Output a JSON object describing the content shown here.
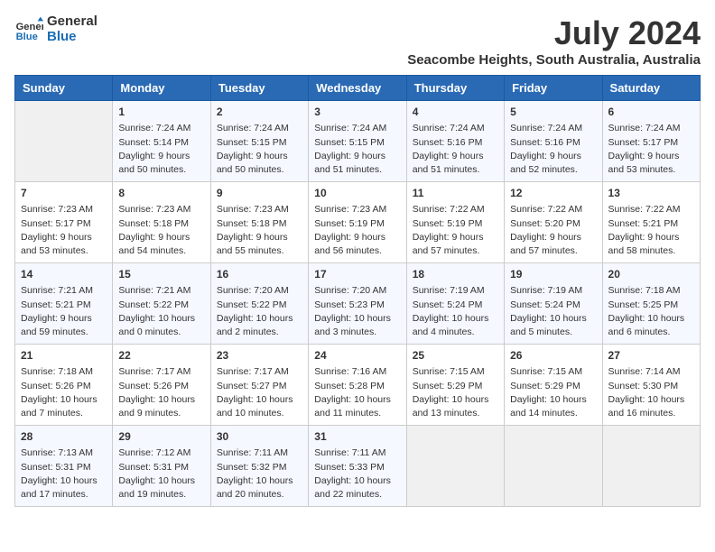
{
  "header": {
    "logo_line1": "General",
    "logo_line2": "Blue",
    "month_year": "July 2024",
    "location": "Seacombe Heights, South Australia, Australia"
  },
  "weekdays": [
    "Sunday",
    "Monday",
    "Tuesday",
    "Wednesday",
    "Thursday",
    "Friday",
    "Saturday"
  ],
  "weeks": [
    [
      {
        "day": "",
        "sunrise": "",
        "sunset": "",
        "daylight": ""
      },
      {
        "day": "1",
        "sunrise": "Sunrise: 7:24 AM",
        "sunset": "Sunset: 5:14 PM",
        "daylight": "Daylight: 9 hours and 50 minutes."
      },
      {
        "day": "2",
        "sunrise": "Sunrise: 7:24 AM",
        "sunset": "Sunset: 5:15 PM",
        "daylight": "Daylight: 9 hours and 50 minutes."
      },
      {
        "day": "3",
        "sunrise": "Sunrise: 7:24 AM",
        "sunset": "Sunset: 5:15 PM",
        "daylight": "Daylight: 9 hours and 51 minutes."
      },
      {
        "day": "4",
        "sunrise": "Sunrise: 7:24 AM",
        "sunset": "Sunset: 5:16 PM",
        "daylight": "Daylight: 9 hours and 51 minutes."
      },
      {
        "day": "5",
        "sunrise": "Sunrise: 7:24 AM",
        "sunset": "Sunset: 5:16 PM",
        "daylight": "Daylight: 9 hours and 52 minutes."
      },
      {
        "day": "6",
        "sunrise": "Sunrise: 7:24 AM",
        "sunset": "Sunset: 5:17 PM",
        "daylight": "Daylight: 9 hours and 53 minutes."
      }
    ],
    [
      {
        "day": "7",
        "sunrise": "Sunrise: 7:23 AM",
        "sunset": "Sunset: 5:17 PM",
        "daylight": "Daylight: 9 hours and 53 minutes."
      },
      {
        "day": "8",
        "sunrise": "Sunrise: 7:23 AM",
        "sunset": "Sunset: 5:18 PM",
        "daylight": "Daylight: 9 hours and 54 minutes."
      },
      {
        "day": "9",
        "sunrise": "Sunrise: 7:23 AM",
        "sunset": "Sunset: 5:18 PM",
        "daylight": "Daylight: 9 hours and 55 minutes."
      },
      {
        "day": "10",
        "sunrise": "Sunrise: 7:23 AM",
        "sunset": "Sunset: 5:19 PM",
        "daylight": "Daylight: 9 hours and 56 minutes."
      },
      {
        "day": "11",
        "sunrise": "Sunrise: 7:22 AM",
        "sunset": "Sunset: 5:19 PM",
        "daylight": "Daylight: 9 hours and 57 minutes."
      },
      {
        "day": "12",
        "sunrise": "Sunrise: 7:22 AM",
        "sunset": "Sunset: 5:20 PM",
        "daylight": "Daylight: 9 hours and 57 minutes."
      },
      {
        "day": "13",
        "sunrise": "Sunrise: 7:22 AM",
        "sunset": "Sunset: 5:21 PM",
        "daylight": "Daylight: 9 hours and 58 minutes."
      }
    ],
    [
      {
        "day": "14",
        "sunrise": "Sunrise: 7:21 AM",
        "sunset": "Sunset: 5:21 PM",
        "daylight": "Daylight: 9 hours and 59 minutes."
      },
      {
        "day": "15",
        "sunrise": "Sunrise: 7:21 AM",
        "sunset": "Sunset: 5:22 PM",
        "daylight": "Daylight: 10 hours and 0 minutes."
      },
      {
        "day": "16",
        "sunrise": "Sunrise: 7:20 AM",
        "sunset": "Sunset: 5:22 PM",
        "daylight": "Daylight: 10 hours and 2 minutes."
      },
      {
        "day": "17",
        "sunrise": "Sunrise: 7:20 AM",
        "sunset": "Sunset: 5:23 PM",
        "daylight": "Daylight: 10 hours and 3 minutes."
      },
      {
        "day": "18",
        "sunrise": "Sunrise: 7:19 AM",
        "sunset": "Sunset: 5:24 PM",
        "daylight": "Daylight: 10 hours and 4 minutes."
      },
      {
        "day": "19",
        "sunrise": "Sunrise: 7:19 AM",
        "sunset": "Sunset: 5:24 PM",
        "daylight": "Daylight: 10 hours and 5 minutes."
      },
      {
        "day": "20",
        "sunrise": "Sunrise: 7:18 AM",
        "sunset": "Sunset: 5:25 PM",
        "daylight": "Daylight: 10 hours and 6 minutes."
      }
    ],
    [
      {
        "day": "21",
        "sunrise": "Sunrise: 7:18 AM",
        "sunset": "Sunset: 5:26 PM",
        "daylight": "Daylight: 10 hours and 7 minutes."
      },
      {
        "day": "22",
        "sunrise": "Sunrise: 7:17 AM",
        "sunset": "Sunset: 5:26 PM",
        "daylight": "Daylight: 10 hours and 9 minutes."
      },
      {
        "day": "23",
        "sunrise": "Sunrise: 7:17 AM",
        "sunset": "Sunset: 5:27 PM",
        "daylight": "Daylight: 10 hours and 10 minutes."
      },
      {
        "day": "24",
        "sunrise": "Sunrise: 7:16 AM",
        "sunset": "Sunset: 5:28 PM",
        "daylight": "Daylight: 10 hours and 11 minutes."
      },
      {
        "day": "25",
        "sunrise": "Sunrise: 7:15 AM",
        "sunset": "Sunset: 5:29 PM",
        "daylight": "Daylight: 10 hours and 13 minutes."
      },
      {
        "day": "26",
        "sunrise": "Sunrise: 7:15 AM",
        "sunset": "Sunset: 5:29 PM",
        "daylight": "Daylight: 10 hours and 14 minutes."
      },
      {
        "day": "27",
        "sunrise": "Sunrise: 7:14 AM",
        "sunset": "Sunset: 5:30 PM",
        "daylight": "Daylight: 10 hours and 16 minutes."
      }
    ],
    [
      {
        "day": "28",
        "sunrise": "Sunrise: 7:13 AM",
        "sunset": "Sunset: 5:31 PM",
        "daylight": "Daylight: 10 hours and 17 minutes."
      },
      {
        "day": "29",
        "sunrise": "Sunrise: 7:12 AM",
        "sunset": "Sunset: 5:31 PM",
        "daylight": "Daylight: 10 hours and 19 minutes."
      },
      {
        "day": "30",
        "sunrise": "Sunrise: 7:11 AM",
        "sunset": "Sunset: 5:32 PM",
        "daylight": "Daylight: 10 hours and 20 minutes."
      },
      {
        "day": "31",
        "sunrise": "Sunrise: 7:11 AM",
        "sunset": "Sunset: 5:33 PM",
        "daylight": "Daylight: 10 hours and 22 minutes."
      },
      {
        "day": "",
        "sunrise": "",
        "sunset": "",
        "daylight": ""
      },
      {
        "day": "",
        "sunrise": "",
        "sunset": "",
        "daylight": ""
      },
      {
        "day": "",
        "sunrise": "",
        "sunset": "",
        "daylight": ""
      }
    ]
  ]
}
